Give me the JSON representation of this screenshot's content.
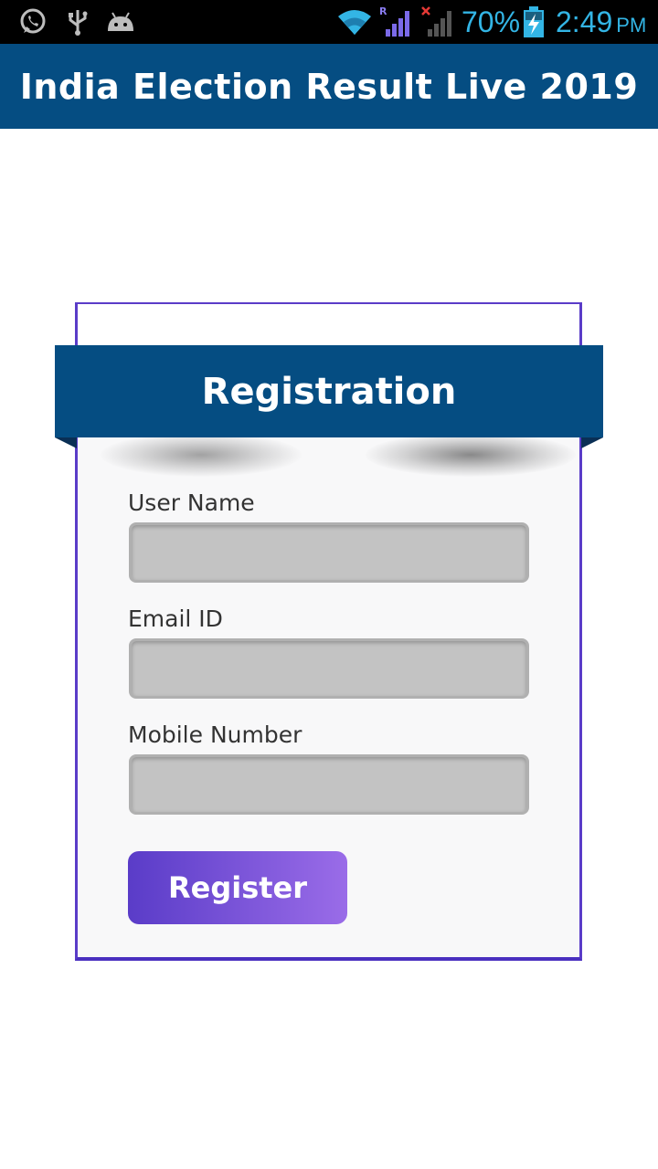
{
  "status_bar": {
    "icons_left": [
      "whatsapp-icon",
      "usb-icon",
      "android-debug-icon"
    ],
    "icons_right": [
      "wifi-icon",
      "signal-roaming-icon",
      "signal-no-service-icon",
      "battery-charging-icon"
    ],
    "battery": "70%",
    "time": "2:49",
    "ampm": "PM",
    "color": "#33b5e5"
  },
  "app_bar": {
    "title": "India Election Result Live 2019",
    "color": "#054d82"
  },
  "form": {
    "title": "Registration",
    "fields": [
      {
        "label": "User Name",
        "value": "",
        "placeholder": ""
      },
      {
        "label": "Email ID",
        "value": "",
        "placeholder": ""
      },
      {
        "label": "Mobile Number",
        "value": "",
        "placeholder": ""
      }
    ],
    "submit_label": "Register",
    "accent_color": "#5a3cc8"
  }
}
